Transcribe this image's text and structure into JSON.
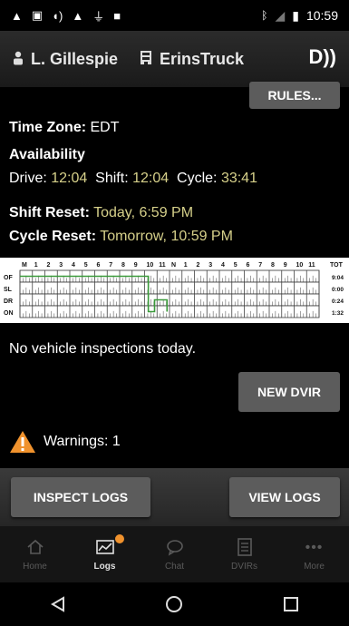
{
  "status_bar": {
    "time": "10:59",
    "left_icons": [
      "alert-icon",
      "notification-icon",
      "sound-icon",
      "alert-icon",
      "usb-icon",
      "shield-icon"
    ],
    "right_icons": [
      "bluetooth-icon",
      "signal-icon",
      "battery-icon"
    ]
  },
  "header": {
    "driver": "L. Gillespie",
    "truck": "ErinsTruck",
    "speaker_glyph": "D))"
  },
  "main": {
    "rules_button": "RULES...",
    "timezone_label": "Time Zone:",
    "timezone_value": "EDT",
    "availability_title": "Availability",
    "drive_label": "Drive:",
    "drive_value": "12:04",
    "shift_label": "Shift:",
    "shift_value": "12:04",
    "cycle_label": "Cycle:",
    "cycle_value": "33:41",
    "shift_reset_label": "Shift Reset:",
    "shift_reset_value": "Today, 6:59 PM",
    "cycle_reset_label": "Cycle Reset:",
    "cycle_reset_value": "Tomorrow, 10:59 PM",
    "no_inspections": "No vehicle inspections today.",
    "new_dvir_button": "NEW DVIR",
    "warnings": "Warnings: 1"
  },
  "log_grid": {
    "hour_labels": [
      "M",
      "1",
      "2",
      "3",
      "4",
      "5",
      "6",
      "7",
      "8",
      "9",
      "10",
      "11",
      "N",
      "1",
      "2",
      "3",
      "4",
      "5",
      "6",
      "7",
      "8",
      "9",
      "10",
      "11"
    ],
    "total_label": "TOT",
    "rows": [
      {
        "label": "OF",
        "total": "9:04"
      },
      {
        "label": "SL",
        "total": "0:00"
      },
      {
        "label": "DR",
        "total": "0:24"
      },
      {
        "label": "ON",
        "total": "1:32"
      }
    ],
    "line_color": "#3a9a3a"
  },
  "actions": {
    "inspect_logs": "INSPECT LOGS",
    "view_logs": "VIEW LOGS"
  },
  "bottom_nav": [
    {
      "label": "Home",
      "icon": "home-icon"
    },
    {
      "label": "Logs",
      "icon": "logs-icon"
    },
    {
      "label": "Chat",
      "icon": "chat-icon"
    },
    {
      "label": "DVIRs",
      "icon": "dvir-icon"
    },
    {
      "label": "More",
      "icon": "more-icon"
    }
  ],
  "colors": {
    "accent": "#f0922d",
    "value_text": "#d6d08a",
    "button": "#5c5c5c"
  }
}
